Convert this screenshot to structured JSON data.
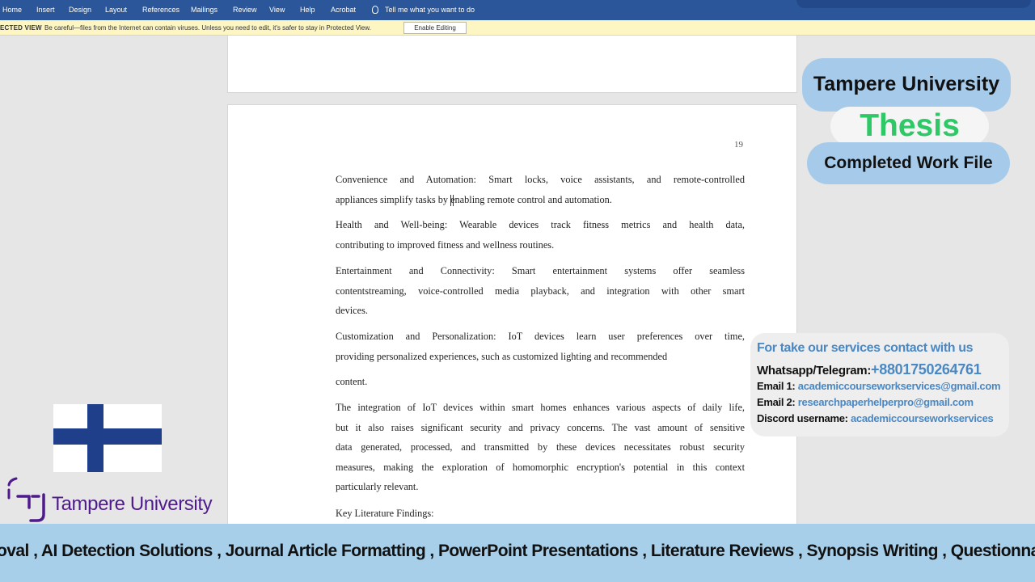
{
  "ribbon": {
    "tabs": [
      "Home",
      "Insert",
      "Design",
      "Layout",
      "References",
      "Mailings",
      "Review",
      "View",
      "Help",
      "Acrobat"
    ],
    "tell_me": "Tell me what you want to do"
  },
  "protected_view": {
    "label": "ECTED VIEW",
    "message": "Be careful—files from the Internet can contain viruses. Unless you need to edit, it's safer to stay in Protected View.",
    "button": "Enable Editing"
  },
  "document": {
    "page_number": "19",
    "paragraphs": [
      [
        "Convenience and Automation: Smart locks, voice assistants, and remote-controlled",
        "appliances simplify tasks by enabling remote control and automation."
      ],
      [
        "Health and Well-being: Wearable devices track fitness metrics and health data,",
        "contributing to improved fitness and wellness routines."
      ],
      [
        "Entertainment and Connectivity: Smart entertainment systems offer seamless",
        "contentstreaming, voice-controlled media playback, and integration with other smart",
        "devices."
      ],
      [
        "Customization and Personalization: IoT devices learn user preferences over time,",
        "providing personalized experiences, such as customized lighting and recommended"
      ],
      [
        "content."
      ],
      [
        "The integration of IoT devices within smart homes enhances various aspects of daily life,",
        "but it also raises significant security and privacy concerns. The vast amount of sensitive",
        "data generated, processed, and transmitted by these devices necessitates robust security",
        "measures, making the exploration of homomorphic encryption's potential in this context",
        "particularly relevant."
      ],
      [
        "Key Literature Findings:"
      ]
    ]
  },
  "promo": {
    "university": "Tampere University",
    "thesis": "Thesis",
    "completed": "Completed Work File",
    "colors": {
      "pill_blue": "#a6cbea",
      "thesis_green": "#2ec866",
      "link_blue": "#4a88c4"
    }
  },
  "contact": {
    "title": "For take our services contact with us",
    "whatsapp_label": "Whatsapp/Telegram:",
    "whatsapp_value": "+8801750264761",
    "email1_label": "Email 1:",
    "email1_value": "academiccourseworkservices@gmail.com",
    "email2_label": "Email 2:",
    "email2_value": "researchpaperhelperpro@gmail.com",
    "discord_label": "Discord username:",
    "discord_value": "academiccourseworkservices"
  },
  "logo": {
    "text": "Tampere University",
    "icon": "tampere-logo-icon"
  },
  "flag": {
    "icon": "finland-flag-icon",
    "colors": {
      "cross": "#1f3f8a",
      "field": "#ffffff"
    }
  },
  "ticker": {
    "text": "oval , AI Detection Solutions , Journal Article Formatting  , PowerPoint Presentations  , Literature Reviews , Synopsis Writing , Questionnaires"
  }
}
